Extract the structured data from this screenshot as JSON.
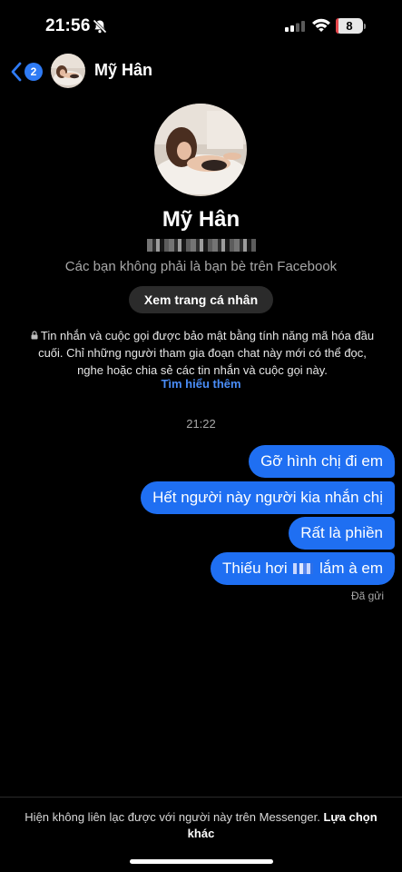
{
  "status_bar": {
    "time": "21:56",
    "battery_level": "8",
    "battery_fraction": 0.08
  },
  "header": {
    "unread_count": "2",
    "contact_name": "Mỹ Hân"
  },
  "profile": {
    "name": "Mỹ Hân",
    "relationship_note": "Các bạn không phải là bạn bè trên Facebook",
    "view_profile_label": "Xem trang cá nhân"
  },
  "encryption": {
    "notice": "Tin nhắn và cuộc gọi được bảo mật bằng tính năng mã hóa đầu cuối. Chỉ những người tham gia đoạn chat này mới có thể đọc, nghe hoặc chia sẻ các tin nhắn và cuộc gọi này.",
    "learn_more": "Tìm hiểu thêm"
  },
  "conversation": {
    "timestamp": "21:22",
    "messages": [
      {
        "text": "Gỡ hình chị đi em"
      },
      {
        "text": "Hết người này người kia nhắn chị"
      },
      {
        "text": "Rất là phiền"
      },
      {
        "text_before": "Thiếu hơi ",
        "text_after": " lắm à em"
      }
    ],
    "delivery_status": "Đã gửi"
  },
  "footer": {
    "notice": "Hiện không liên lạc được với người này trên Messenger. ",
    "link": "Lựa chọn khác"
  },
  "colors": {
    "bubble": "#1f6ff2",
    "accent_link": "#4a8df7",
    "badge": "#2f7bf5",
    "background": "#000000"
  }
}
